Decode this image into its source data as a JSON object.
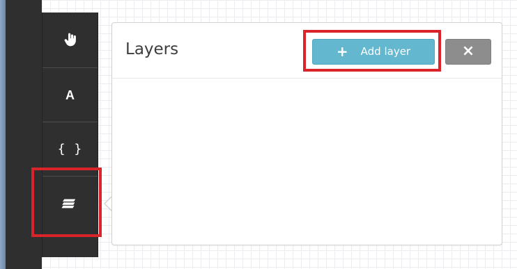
{
  "toolbar": {
    "items": [
      {
        "name": "hand-tool",
        "icon": "hand-pointer-icon"
      },
      {
        "name": "text-tool",
        "label": "A"
      },
      {
        "name": "code-tool",
        "label": "{ }"
      },
      {
        "name": "layers-tool",
        "icon": "layers-icon"
      }
    ]
  },
  "layers_panel": {
    "title": "Layers",
    "add_layer_label": "Add layer",
    "add_layer_icon": "plus-icon",
    "close_icon": "close-icon"
  },
  "colors": {
    "toolbar_bg": "#2f2f2f",
    "add_button": "#63b7cf",
    "close_button": "#8d8d8d",
    "highlight": "#d8242a"
  }
}
